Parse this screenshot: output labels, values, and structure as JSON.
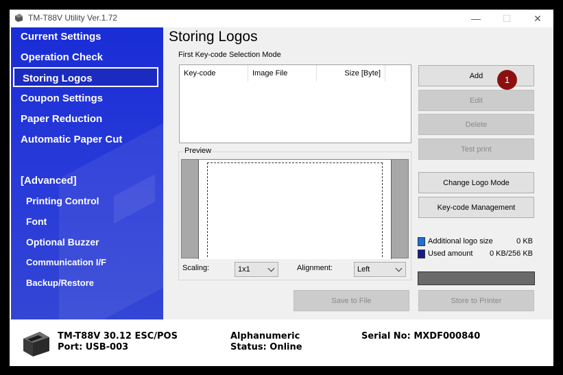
{
  "window": {
    "title": "TM-T88V Utility Ver.1.72",
    "controls": {
      "minimize": "—",
      "maximize": "☐",
      "close": "✕"
    }
  },
  "sidebar": {
    "items": [
      {
        "label": "Current Settings"
      },
      {
        "label": "Operation Check"
      },
      {
        "label": "Storing Logos",
        "selected": true
      },
      {
        "label": "Coupon Settings"
      },
      {
        "label": "Paper Reduction"
      },
      {
        "label": "Automatic Paper Cut"
      }
    ],
    "advanced_header": "[Advanced]",
    "advanced_items": [
      {
        "label": "Printing Control"
      },
      {
        "label": "Font"
      },
      {
        "label": "Optional Buzzer"
      },
      {
        "label": "Communication I/F"
      },
      {
        "label": "Backup/Restore"
      }
    ]
  },
  "main": {
    "title": "Storing Logos",
    "mode_label": "First Key-code Selection Mode",
    "table": {
      "columns": [
        "Key-code",
        "Image File",
        "Size [Byte]"
      ],
      "rows": []
    },
    "preview": {
      "label": "Preview",
      "scaling_label": "Scaling:",
      "scaling_value": "1x1",
      "alignment_label": "Alignment:",
      "alignment_value": "Left"
    },
    "buttons": {
      "add": "Add",
      "edit": "Edit",
      "delete": "Delete",
      "test_print": "Test print",
      "change_logo_mode": "Change Logo Mode",
      "keycode_management": "Key-code Management",
      "save_to_file": "Save to File",
      "store_to_printer": "Store to Printer"
    },
    "annotation_badge": "1",
    "legend": {
      "additional_label": "Additional logo size",
      "additional_value": "0 KB",
      "additional_color": "#1e6fd9",
      "used_label": "Used amount",
      "used_value": "0 KB/256 KB",
      "used_color": "#1a1a8c"
    }
  },
  "status": {
    "model": "TM-T88V 30.12 ESC/POS",
    "port": "Port: USB-003",
    "mode": "Alphanumeric",
    "status": "Status: Online",
    "serial": "Serial No: MXDF000840"
  },
  "colors": {
    "sidebar": "#2233d6",
    "badge": "#8b1010"
  }
}
